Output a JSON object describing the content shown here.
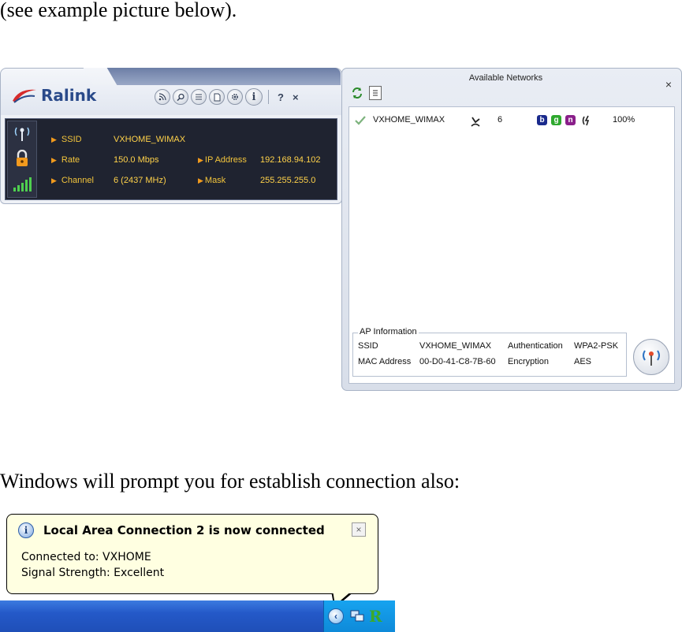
{
  "doc": {
    "intro": "(see example picture below).",
    "prompt": "Windows will prompt you for establish connection also:"
  },
  "ralink": {
    "logo": "Ralink",
    "toolbar": [
      "rss-icon",
      "search-icon",
      "list-icon",
      "page-icon",
      "gear-icon",
      "info-icon"
    ],
    "info_glyph": "i",
    "help": "?",
    "close": "×",
    "ssid_label": "SSID",
    "ssid_value": "VXHOME_WIMAX",
    "rate_label": "Rate",
    "rate_value": "150.0 Mbps",
    "channel_label": "Channel",
    "channel_value": "6 (2437 MHz)",
    "ip_label": "IP Address",
    "ip_value": "192.168.94.102",
    "mask_label": "Mask",
    "mask_value": "255.255.255.0",
    "colors": {
      "label": "#f3c53c",
      "panel": "#1f2330"
    }
  },
  "available": {
    "title": "Available Networks",
    "close": "×",
    "networks": [
      {
        "ssid": "VXHOME_WIMAX",
        "channel": "6",
        "b": "b",
        "g": "g",
        "n": "n",
        "signal": "100%"
      }
    ],
    "ap_info": {
      "legend": "AP Information",
      "ssid_label": "SSID",
      "ssid_value": "VXHOME_WIMAX",
      "auth_label": "Authentication",
      "auth_value": "WPA2-PSK",
      "mac_label": "MAC Address",
      "mac_value": "00-D0-41-C8-7B-60",
      "enc_label": "Encryption",
      "enc_value": "AES"
    },
    "badge_colors": {
      "b": "#1a2a8c",
      "g": "#2ea82e",
      "n": "#8a1f8a"
    }
  },
  "balloon": {
    "title": "Local Area Connection 2 is now connected",
    "close": "×",
    "info_glyph": "i",
    "line1": "Connected to: VXHOME",
    "line2": "Signal Strength: Excellent"
  },
  "tray": {
    "chevron": "‹",
    "r_glyph": "R"
  }
}
